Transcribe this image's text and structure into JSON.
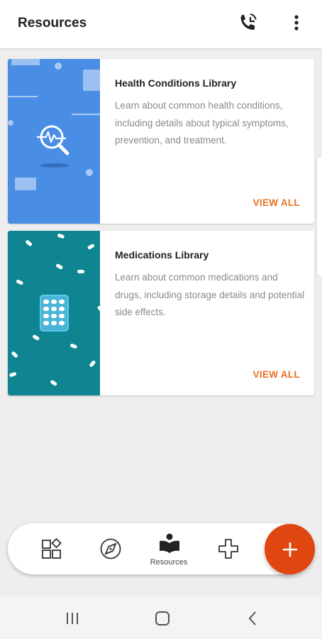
{
  "app_bar": {
    "title": "Resources",
    "icons": [
      "phone-callback-icon",
      "more-vert-icon"
    ]
  },
  "cards": [
    {
      "title": "Health Conditions Library",
      "description": "Learn about common health conditions, including details about typical symptoms, prevention, and treatment.",
      "action": "VIEW ALL",
      "art_color": "#4a8de4",
      "icon": "health-search-icon"
    },
    {
      "title": "Medications Library",
      "description": "Learn about common medications and drugs, including storage details and potential side effects.",
      "action": "VIEW ALL",
      "art_color": "#0e8590",
      "icon": "pill-pack-icon"
    }
  ],
  "bottom_nav": {
    "items": [
      {
        "icon": "dashboard-icon",
        "label": ""
      },
      {
        "icon": "compass-icon",
        "label": ""
      },
      {
        "icon": "book-reader-icon",
        "label": "Resources"
      },
      {
        "icon": "medical-cross-icon",
        "label": ""
      }
    ],
    "fab_icon": "plus-icon"
  },
  "system_nav": [
    "recents-icon",
    "home-icon",
    "back-icon"
  ],
  "colors": {
    "accent": "#e8711c",
    "fab": "#e0460f",
    "health_art": "#4a8de4",
    "med_art": "#0e8590"
  }
}
